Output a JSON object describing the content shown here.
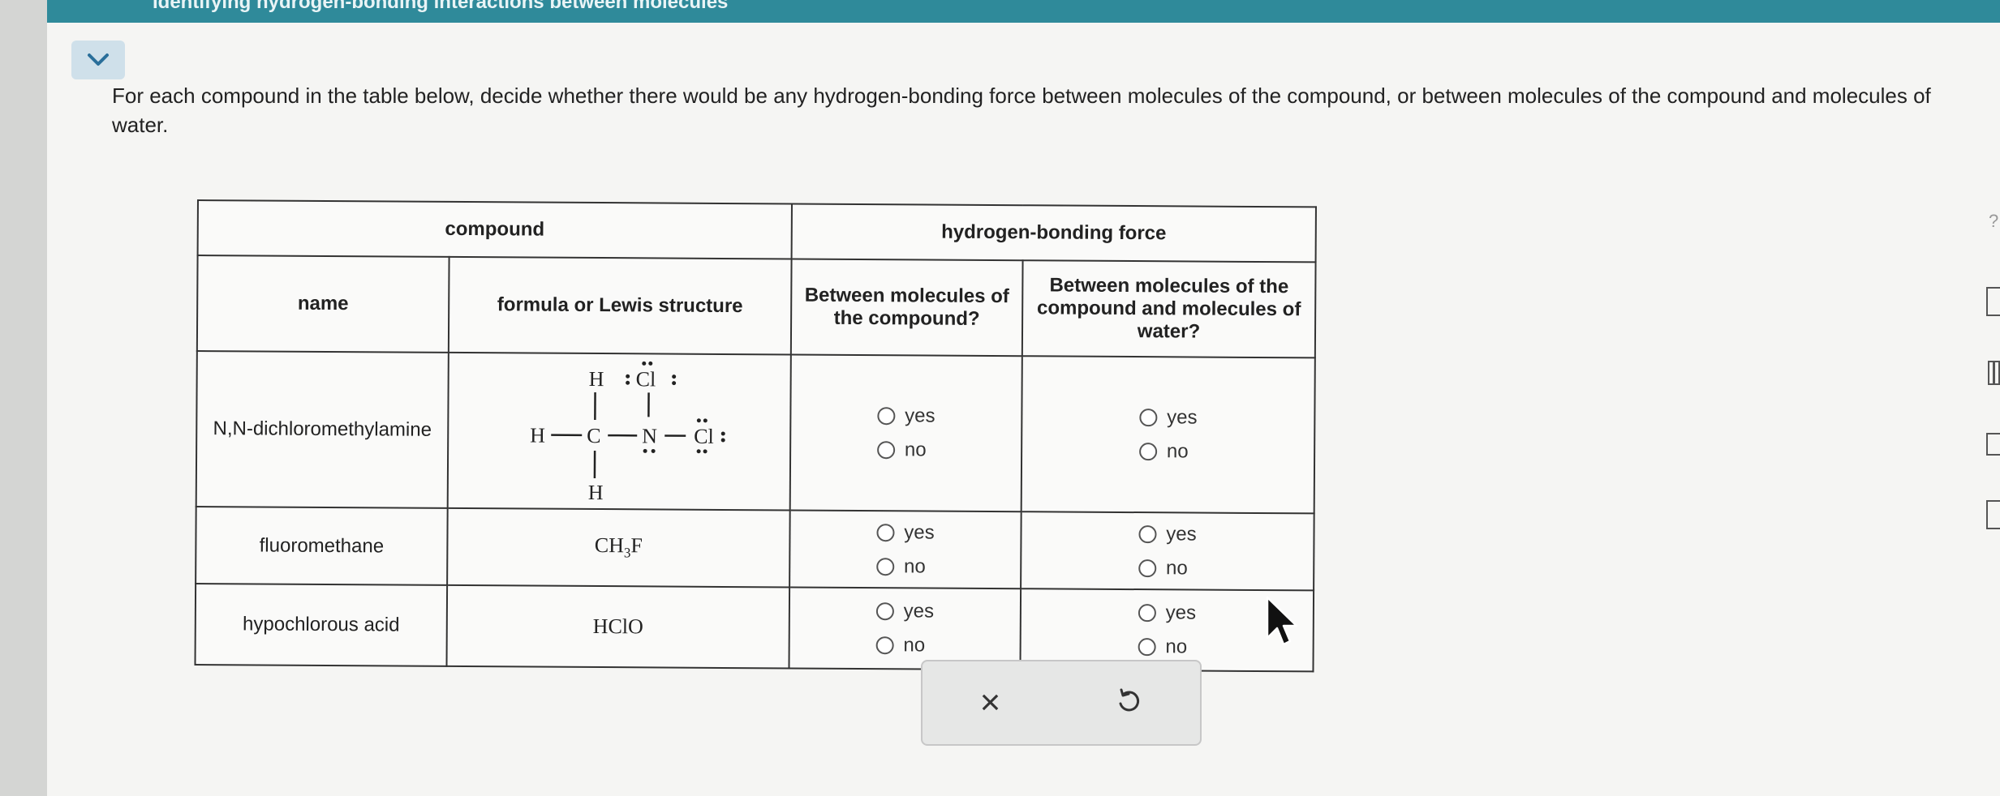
{
  "banner": {
    "title": "Identifying hydrogen-bonding interactions between molecules"
  },
  "instructions": "For each compound in the table below, decide whether there would be any hydrogen-bonding force between molecules of the compound, or between molecules of the compound and molecules of water.",
  "table": {
    "header_group_compound": "compound",
    "header_group_hbond": "hydrogen-bonding force",
    "col_name": "name",
    "col_formula": "formula or Lewis structure",
    "col_between_compound": "Between molecules of the compound?",
    "col_between_water": "Between molecules of the compound and molecules of water?",
    "rows": [
      {
        "name": "N,N-dichloromethylamine",
        "formula": "",
        "yes": "yes",
        "no": "no"
      },
      {
        "name": "fluoromethane",
        "formula_main": "CH",
        "formula_sub": "3",
        "formula_end": "F",
        "yes": "yes",
        "no": "no"
      },
      {
        "name": "hypochlorous acid",
        "formula": "HClO",
        "yes": "yes",
        "no": "no"
      }
    ]
  },
  "lewis": {
    "H": "H",
    "C": "C",
    "N": "N",
    "Cl": "Cl",
    "bond_h": "—",
    "bond_v": "|"
  },
  "actions": {
    "clear_label": "×",
    "undo_icon": "undo-icon"
  }
}
